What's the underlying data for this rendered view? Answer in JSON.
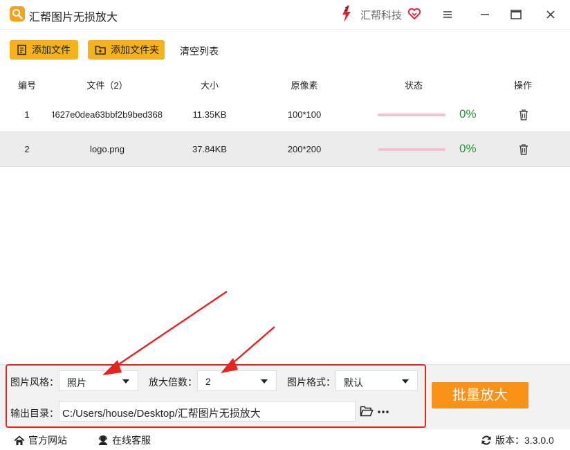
{
  "app": {
    "title": "汇帮图片无损放大"
  },
  "brand": {
    "name": "汇帮科技"
  },
  "toolbar": {
    "add_file": "添加文件",
    "add_folder": "添加文件夹",
    "clear_list": "清空列表"
  },
  "table": {
    "headers": {
      "index": "编号",
      "file": "文件（2）",
      "size": "大小",
      "pixels": "原像素",
      "status": "状态",
      "action": "操作"
    },
    "rows": [
      {
        "index": "1",
        "file": "4627e0dea63bbf2b9bed368",
        "size": "11.35KB",
        "pixels": "100*100",
        "progress": 0,
        "percent": "0%"
      },
      {
        "index": "2",
        "file": "logo.png",
        "size": "37.84KB",
        "pixels": "200*200",
        "progress": 0,
        "percent": "0%"
      }
    ]
  },
  "settings": {
    "style_label": "图片风格：",
    "style_value": "照片",
    "scale_label": "放大倍数：",
    "scale_value": "2",
    "format_label": "图片格式：",
    "format_value": "默认",
    "output_label": "输出目录：",
    "output_value": "C:/Users/house/Desktop/汇帮图片无损放大",
    "more": "···"
  },
  "actions": {
    "batch": "批量放大"
  },
  "statusbar": {
    "website": "官方网站",
    "support": "在线客服",
    "version": "版本：3.3.0.0"
  },
  "colors": {
    "accent": "#f6b21a",
    "primary_button": "#f99317",
    "progress_percent": "#1f9b35",
    "annotation": "#e52520"
  },
  "icons": [
    "app-logo-icon",
    "brand-logo-icon",
    "heart-icon",
    "menu-icon",
    "minimize-icon",
    "maximize-icon",
    "close-icon",
    "add-file-icon",
    "add-folder-icon",
    "trash-icon",
    "folder-open-icon",
    "more-icon",
    "home-icon",
    "support-icon",
    "refresh-icon"
  ]
}
